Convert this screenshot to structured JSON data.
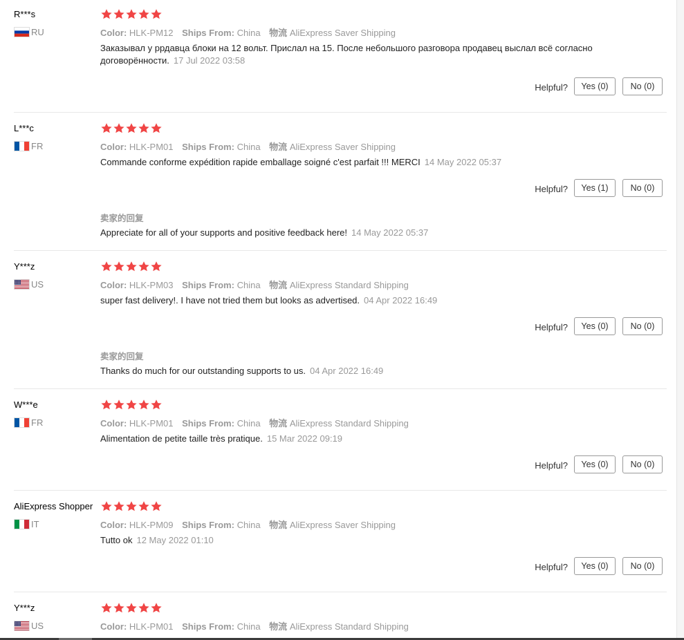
{
  "labels": {
    "color": "Color:",
    "ships_from": "Ships From:",
    "logistics": "物流",
    "helpful": "Helpful?",
    "seller_reply_title": "卖家的回复"
  },
  "colors": {
    "star": "#f04545",
    "meta": "#999999",
    "divider": "#e8e8e8"
  },
  "reviews": [
    {
      "user": "R***s",
      "country": "RU",
      "rating": 5,
      "color": "HLK-PM12",
      "ships_from": "China",
      "shipping": "AliExpress Saver Shipping",
      "text": "Заказывал у ррдавца блоки на 12 вольт. Прислал на 15. После небольшого разговора продавец выслал всё согласно договорённости.",
      "date": "17 Jul 2022 03:58",
      "yes": "Yes (0)",
      "no": "No (0)"
    },
    {
      "user": "L***c",
      "country": "FR",
      "rating": 5,
      "color": "HLK-PM01",
      "ships_from": "China",
      "shipping": "AliExpress Saver Shipping",
      "text": "Commande conforme expédition rapide emballage soigné c'est parfait !!! MERCI",
      "date": "14 May 2022 05:37",
      "yes": "Yes (1)",
      "no": "No (0)",
      "seller_reply": {
        "text": "Appreciate for all of your supports and positive feedback here!",
        "date": "14 May 2022 05:37"
      }
    },
    {
      "user": "Y***z",
      "country": "US",
      "rating": 5,
      "color": "HLK-PM03",
      "ships_from": "China",
      "shipping": "AliExpress Standard Shipping",
      "text": "super fast delivery!. I have not tried them but looks as advertised.",
      "date": "04 Apr 2022 16:49",
      "yes": "Yes (0)",
      "no": "No (0)",
      "seller_reply": {
        "text": "Thanks do much for our outstanding supports to us.",
        "date": "04 Apr 2022 16:49"
      }
    },
    {
      "user": "W***e",
      "country": "FR",
      "rating": 5,
      "color": "HLK-PM01",
      "ships_from": "China",
      "shipping": "AliExpress Standard Shipping",
      "text": "Alimentation de petite taille très pratique.",
      "date": "15 Mar 2022 09:19",
      "yes": "Yes (0)",
      "no": "No (0)"
    },
    {
      "user": "AliExpress Shopper",
      "country": "IT",
      "rating": 5,
      "color": "HLK-PM09",
      "ships_from": "China",
      "shipping": "AliExpress Saver Shipping",
      "text": "Tutto ok",
      "date": "12 May 2022 01:10",
      "yes": "Yes (0)",
      "no": "No (0)"
    },
    {
      "user": "Y***z",
      "country": "US",
      "rating": 5,
      "color": "HLK-PM01",
      "ships_from": "China",
      "shipping": "AliExpress Standard Shipping"
    }
  ]
}
